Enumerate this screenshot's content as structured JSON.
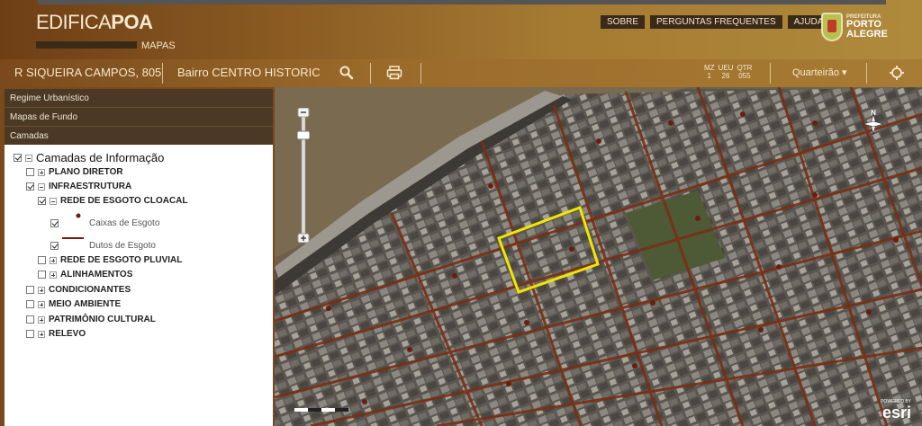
{
  "header": {
    "brand_prefix": "EDIFICA",
    "brand_suffix": "POA",
    "subtitle": "MAPAS",
    "nav": [
      "SOBRE",
      "PERGUNTAS FREQUENTES",
      "AJUDA"
    ],
    "logo_line1": "PREFEITURA",
    "logo_line2": "PORTO",
    "logo_line3": "ALEGRE"
  },
  "toolbar": {
    "address": "R SIQUEIRA CAMPOS, 805",
    "bairro": "Bairro CENTRO HISTORIC",
    "mz_labels": [
      "MZ",
      "UEU",
      "QTR"
    ],
    "mz_values": [
      "1",
      "26",
      "055"
    ],
    "quarteirao": "Quarteirão ▾",
    "icons": [
      "search-icon",
      "print-icon",
      "locate-icon"
    ]
  },
  "panel": {
    "sections": [
      "Regime Urbanístico",
      "Mapas de Fundo",
      "Camadas"
    ],
    "tree": {
      "root": "Camadas de Informação",
      "plano_diretor": "PLANO DIRETOR",
      "infraestrutura": "INFRAESTRUTURA",
      "rede_cloacal": "REDE DE ESGOTO CLOACAL",
      "caixas": "Caixas de Esgoto",
      "dutos": "Dutos de Esgoto",
      "rede_pluvial": "REDE DE ESGOTO PLUVIAL",
      "alinhamentos": "ALINHAMENTOS",
      "condicionantes": "CONDICIONANTES",
      "meio_ambiente": "MEIO AMBIENTE",
      "patrimonio": "PATRIMÔNIO CULTURAL",
      "relevo": "RELEVO"
    }
  },
  "map": {
    "compass_label": "N",
    "attribution_small": "POWERED BY",
    "attribution_brand": "esri",
    "colors": {
      "sewer": "#7a2e14",
      "highlight": "#f2e600",
      "water": "#6e6048"
    }
  }
}
